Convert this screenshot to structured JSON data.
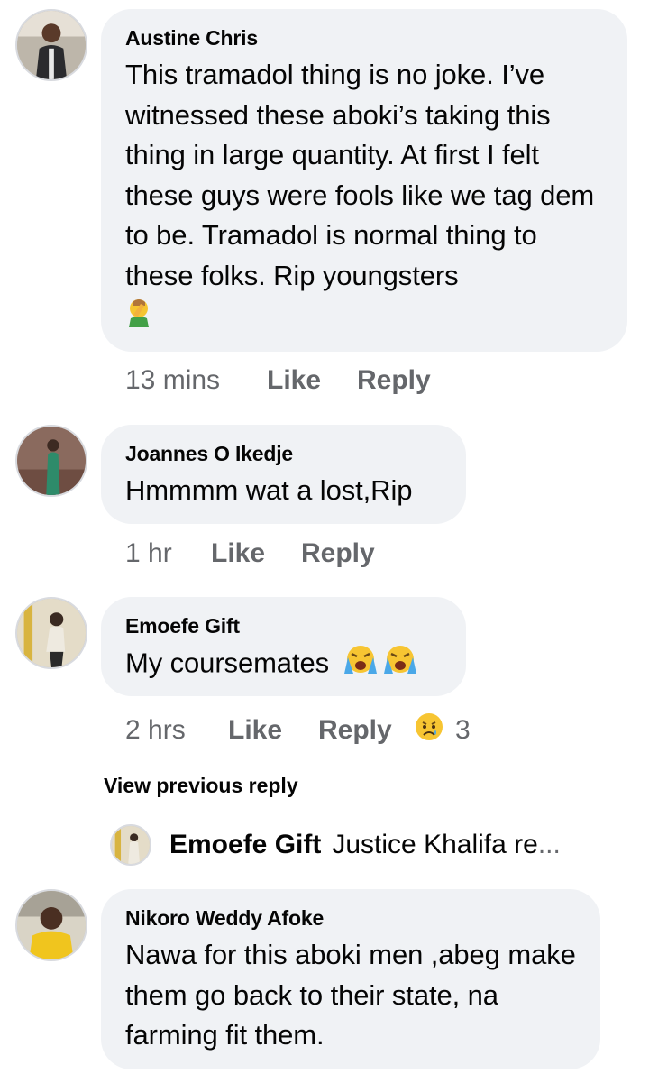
{
  "comments": [
    {
      "author": "Austine Chris",
      "text": "This tramadol thing is no joke. I’ve witnessed these aboki’s taking this thing in large quantity. At first I felt these guys were fools like we tag dem to be. Tramadol is normal thing to these folks. Rip youngsters",
      "emoji": "face-palm-emoji",
      "time": "13 mins",
      "like": "Like",
      "reply": "Reply"
    },
    {
      "author": "Joannes O Ikedje",
      "text": "Hmmmm wat a lost,Rip",
      "time": "1 hr",
      "like": "Like",
      "reply": "Reply"
    },
    {
      "author": "Emoefe Gift",
      "text": "My coursemates",
      "emoji": "loudly-crying-face-emoji",
      "time": "2 hrs",
      "like": "Like",
      "reply": "Reply",
      "reaction_icon": "sad-reaction-icon",
      "reaction_count": "3"
    },
    {
      "author": "Nikoro Weddy Afoke",
      "text": "Nawa for this aboki men ,abeg make them go back to their state, na farming fit them."
    }
  ],
  "view_previous": "View previous reply",
  "reply_preview": {
    "author": "Emoefe Gift",
    "text": "Justice Khalifa re",
    "ellipsis": "..."
  },
  "colors": {
    "bubble": "#f0f2f5",
    "meta_text": "#65676b",
    "text": "#050505"
  }
}
